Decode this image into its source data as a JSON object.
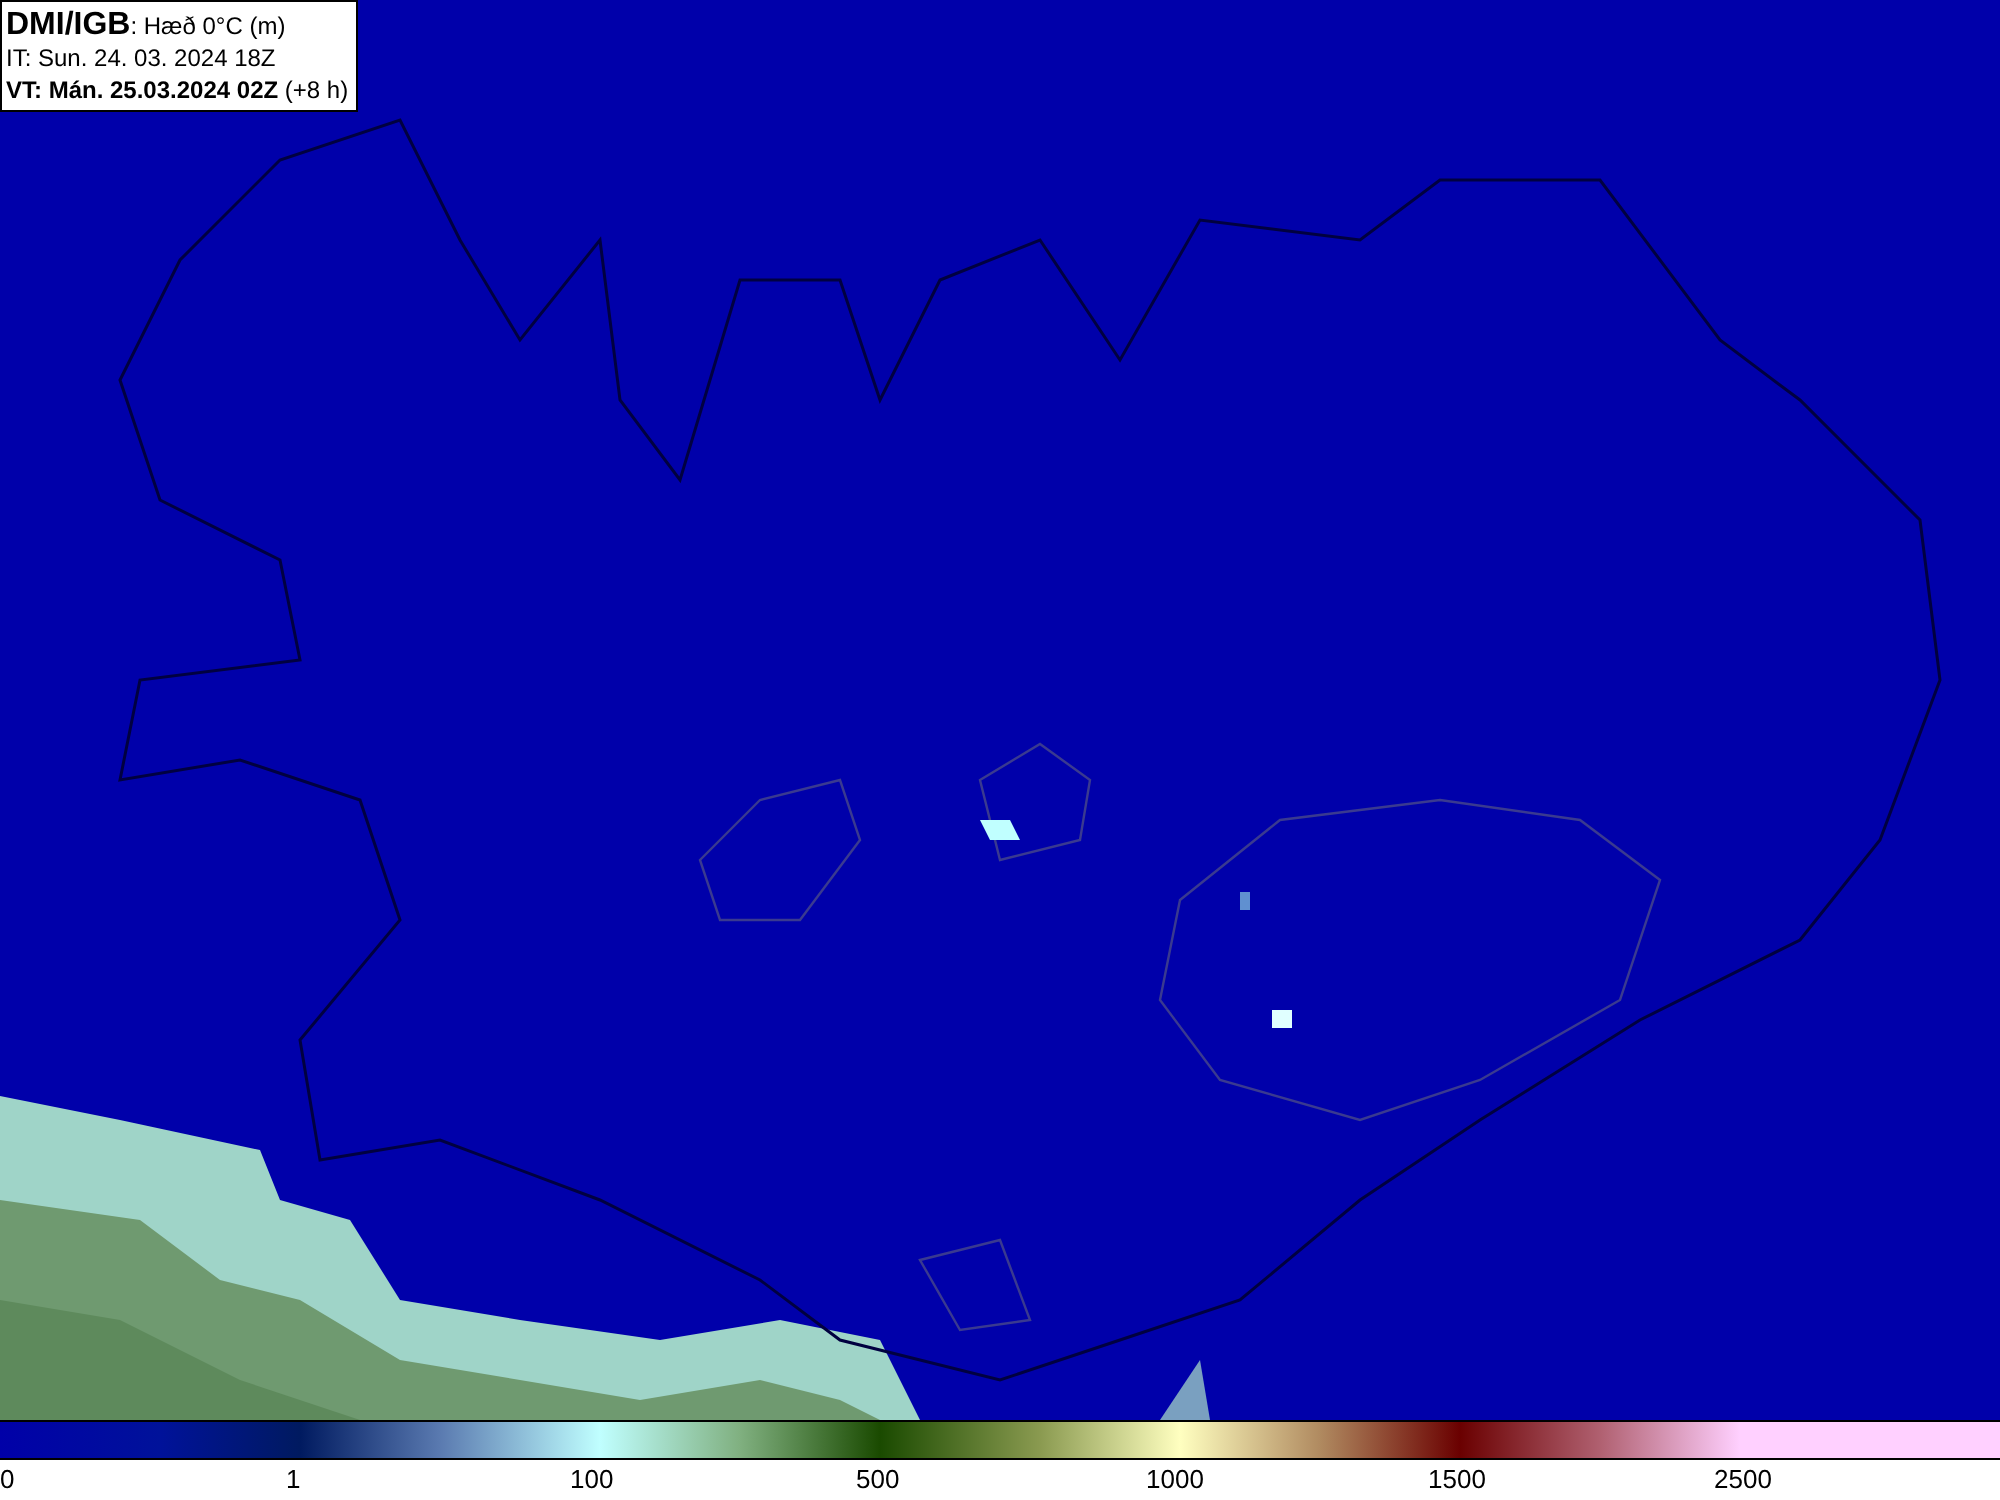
{
  "header": {
    "title": "**DMI/IGB**: Hæð 0°C (m)",
    "initial_time": "IT: Sun. 24. 03. 2024 18Z",
    "valid_time": "**VT: Mán. 25.03.2024 02Z** (+8 h)"
  },
  "colorbar": {
    "ticks": [
      "0",
      "1",
      "100",
      "500",
      "1000",
      "1500",
      "2500"
    ]
  }
}
